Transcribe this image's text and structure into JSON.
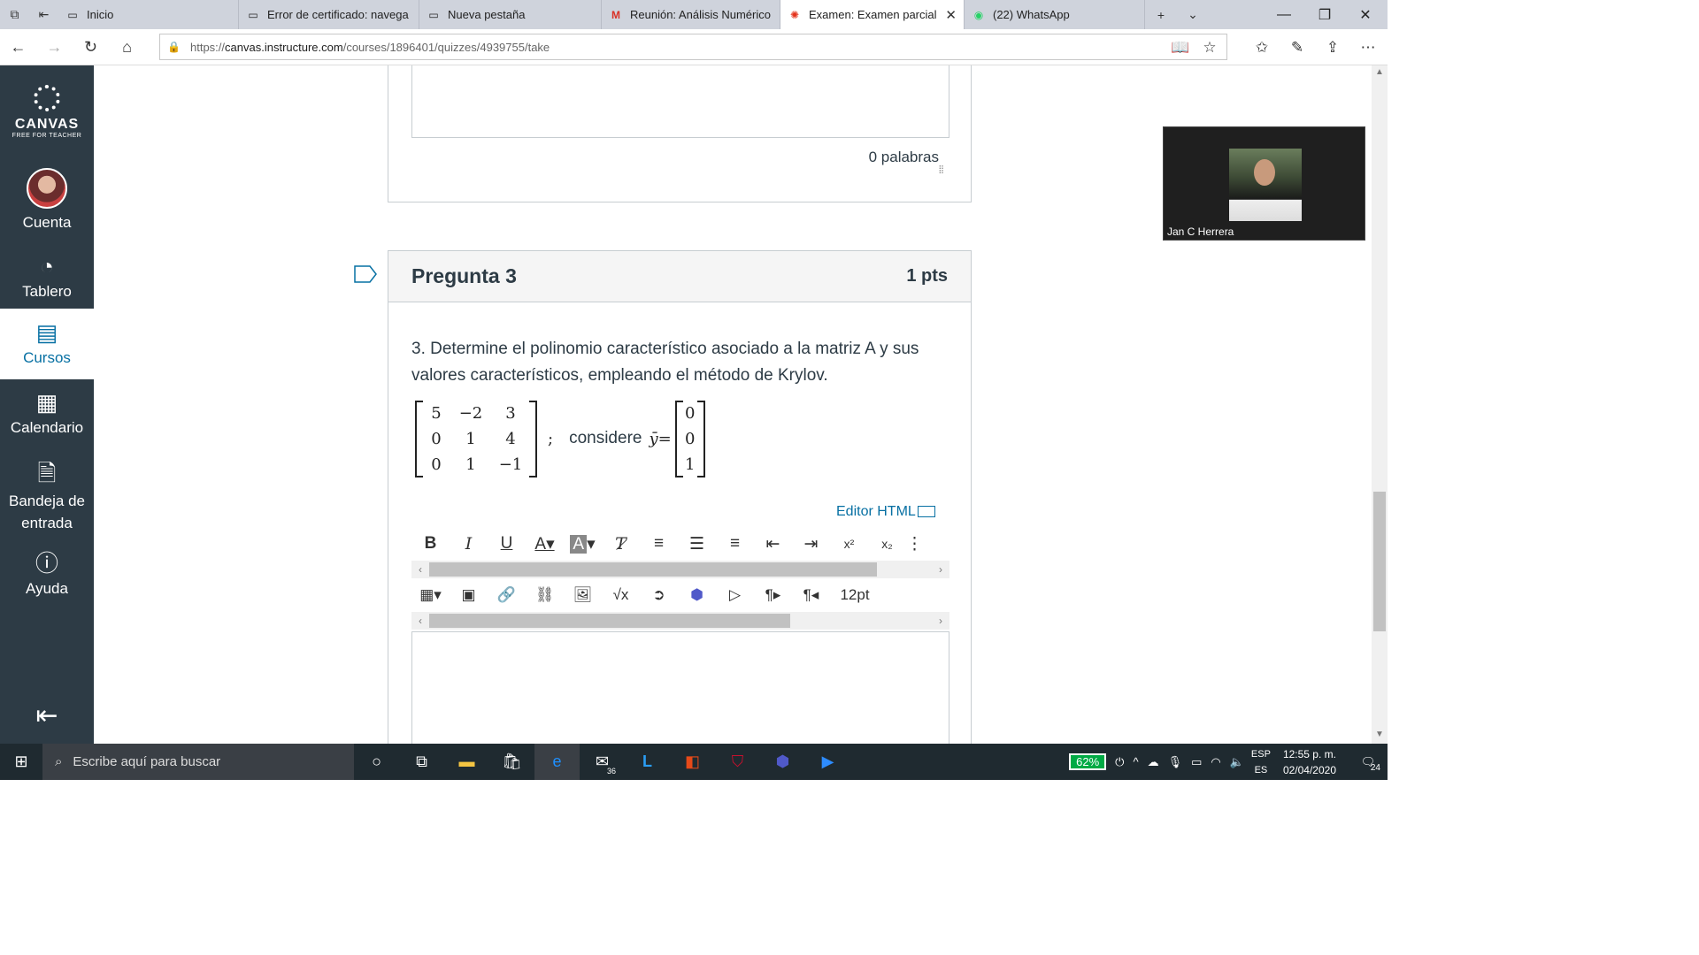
{
  "tabs": [
    {
      "label": "Inicio",
      "icon": "page-icon"
    },
    {
      "label": "Error de certificado: navega",
      "icon": "page-icon"
    },
    {
      "label": "Nueva pestaña",
      "icon": "page-icon"
    },
    {
      "label": "Reunión: Análisis Numérico",
      "icon": "gmail-icon"
    },
    {
      "label": "Examen: Examen parcial",
      "icon": "canvas-icon"
    },
    {
      "label": "(22) WhatsApp",
      "icon": "whatsapp-icon"
    }
  ],
  "address": {
    "url_prefix": "https://",
    "url_host": "canvas.instructure.com",
    "url_path": "/courses/1896401/quizzes/4939755/take"
  },
  "sidebar": {
    "logo_word": "CANVAS",
    "logo_sub": "FREE FOR TEACHER",
    "items": [
      {
        "label": "Cuenta"
      },
      {
        "label": "Tablero"
      },
      {
        "label": "Cursos"
      },
      {
        "label": "Calendario"
      },
      {
        "label": "Bandeja de entrada"
      },
      {
        "label": "Ayuda"
      }
    ]
  },
  "previous_question": {
    "word_count": "0 palabras"
  },
  "question": {
    "title": "Pregunta 3",
    "points": "1 pts",
    "text": "3. Determine el polinomio característico asociado a la matriz A y sus valores característicos, empleando el método de Krylov.",
    "matrix_a": [
      [
        "5",
        "−2",
        "3"
      ],
      [
        "0",
        "1",
        "4"
      ],
      [
        "0",
        "1",
        "−1"
      ]
    ],
    "separator": ";",
    "consider_label": "considere",
    "y_label": "ȳ=",
    "vector_y": [
      "0",
      "0",
      "1"
    ]
  },
  "editor": {
    "html_editor_label": "Editor HTML",
    "font_size": "12pt"
  },
  "video": {
    "participant_name": "Jan C Herrera"
  },
  "taskbar": {
    "search_placeholder": "Escribe aquí para buscar",
    "mail_badge": "36",
    "battery": "62%",
    "lang_top": "ESP",
    "lang_bottom": "ES",
    "time": "12:55 p. m.",
    "date": "02/04/2020",
    "notif_count": "24"
  }
}
